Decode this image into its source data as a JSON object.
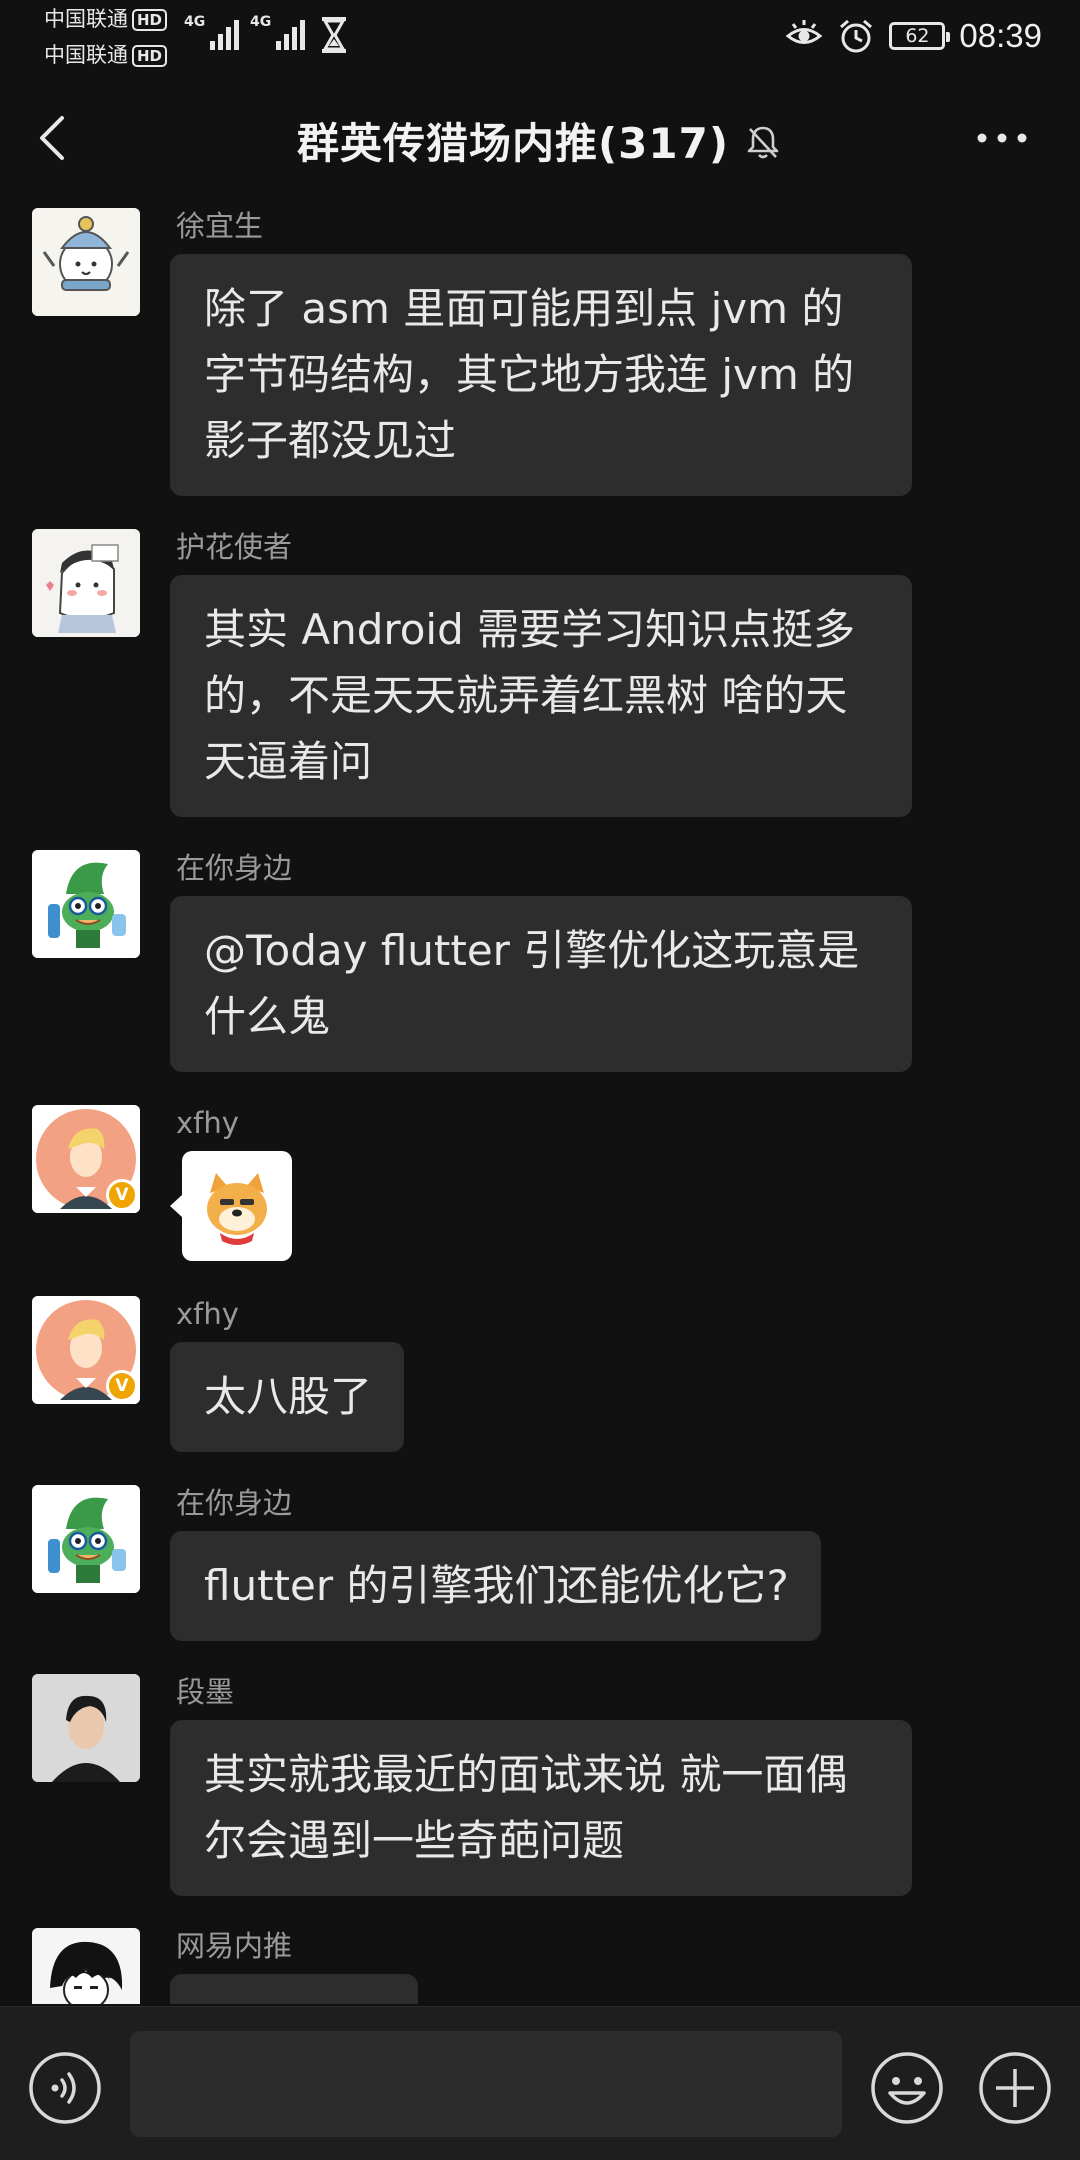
{
  "status_bar": {
    "carrier1": "中国联通",
    "carrier2": "中国联通",
    "hd": "HD",
    "network1": "4G",
    "network2": "4G",
    "battery": "62",
    "time": "08:39"
  },
  "header": {
    "title": "群英传猎场内推(317)",
    "back_icon": "chevron-left-icon",
    "mute_icon": "bell-off-icon",
    "more_icon": "more-dots-icon"
  },
  "messages": [
    {
      "sender": "徐宜生",
      "text": "除了 asm 里面可能用到点 jvm 的字节码结构，其它地方我连 jvm 的影子都没见过"
    },
    {
      "sender": "护花使者",
      "text": "其实 Android 需要学习知识点挺多的，不是天天就弄着红黑树  啥的天天逼着问"
    },
    {
      "sender": "在你身边",
      "text": "@Today flutter 引擎优化这玩意是什么鬼"
    },
    {
      "sender": "xfhy",
      "sticker": "doge-sticker",
      "badge": "V"
    },
    {
      "sender": "xfhy",
      "text": "太八股了",
      "badge": "V"
    },
    {
      "sender": "在你身边",
      "text": "flutter 的引擎我们还能优化它?"
    },
    {
      "sender": "段墨",
      "text": "其实就我最近的面试来说  就一面偶尔会遇到一些奇葩问题"
    },
    {
      "sender": "网易内推",
      "text": ""
    }
  ],
  "input_bar": {
    "placeholder": "",
    "voice_icon": "voice-icon",
    "emoji_icon": "emoji-icon",
    "plus_icon": "plus-icon"
  },
  "colors": {
    "background": "#111111",
    "bubble": "#2d2d2d",
    "sender_name": "#9a9a9a",
    "message_text": "#e9e9e9",
    "badge": "#f0a400"
  }
}
